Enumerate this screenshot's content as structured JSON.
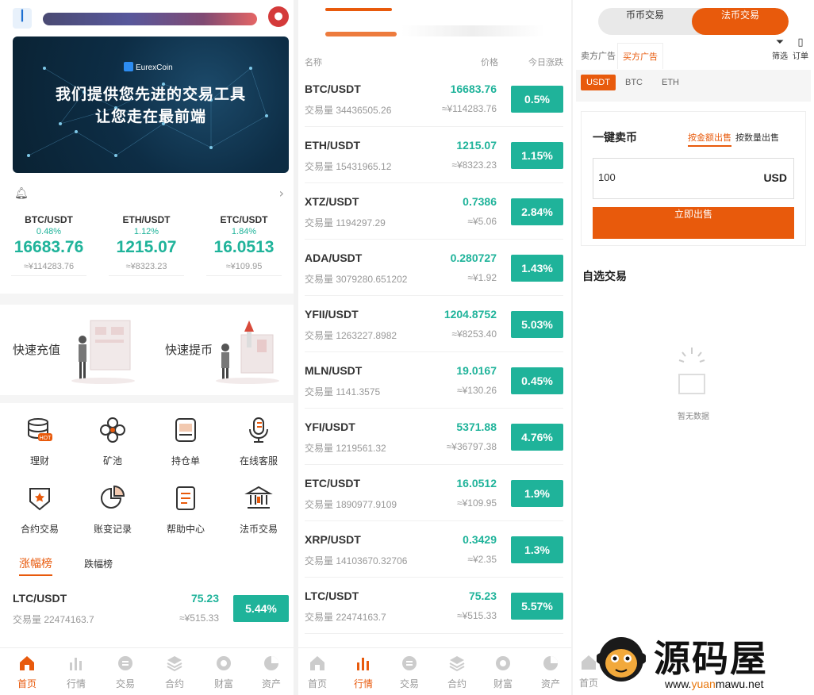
{
  "colors": {
    "accent": "#e85a0c",
    "up": "#1fb39a",
    "muted": "#999999"
  },
  "home": {
    "banner": {
      "brand": "EurexCoin",
      "line1": "我们提供您先进的交易工具",
      "line2": "让您走在最前端"
    },
    "tickers": [
      {
        "pair": "BTC/USDT",
        "change": "0.48%",
        "price": "16683.76",
        "cny": "≈¥114283.76"
      },
      {
        "pair": "ETH/USDT",
        "change": "1.12%",
        "price": "1215.07",
        "cny": "≈¥8323.23"
      },
      {
        "pair": "ETC/USDT",
        "change": "1.84%",
        "price": "16.0513",
        "cny": "≈¥109.95"
      }
    ],
    "quick": {
      "deposit": "快速充值",
      "withdraw": "快速提币"
    },
    "grid": [
      {
        "label": "理财",
        "icon": "coins-hot-icon"
      },
      {
        "label": "矿池",
        "icon": "mining-pool-icon"
      },
      {
        "label": "持仓单",
        "icon": "position-icon"
      },
      {
        "label": "在线客服",
        "icon": "microphone-icon"
      },
      {
        "label": "合约交易",
        "icon": "shield-icon"
      },
      {
        "label": "账变记录",
        "icon": "pie-chart-icon"
      },
      {
        "label": "帮助中心",
        "icon": "document-icon"
      },
      {
        "label": "法币交易",
        "icon": "bank-icon"
      }
    ],
    "tabs": {
      "gainers": "涨幅榜",
      "losers": "跌幅榜"
    },
    "top_row": {
      "pair": "LTC/USDT",
      "vol": "交易量 22474163.7",
      "price": "75.23",
      "cny": "≈¥515.33",
      "pct": "5.44%"
    }
  },
  "market": {
    "header": {
      "name": "名称",
      "price": "价格",
      "change": "今日涨跌"
    },
    "rows": [
      {
        "pair": "BTC/USDT",
        "vol": "交易量 34436505.26",
        "price": "16683.76",
        "cny": "≈¥114283.76",
        "pct": "0.5%"
      },
      {
        "pair": "ETH/USDT",
        "vol": "交易量 15431965.12",
        "price": "1215.07",
        "cny": "≈¥8323.23",
        "pct": "1.15%"
      },
      {
        "pair": "XTZ/USDT",
        "vol": "交易量 1194297.29",
        "price": "0.7386",
        "cny": "≈¥5.06",
        "pct": "2.84%"
      },
      {
        "pair": "ADA/USDT",
        "vol": "交易量 3079280.651202",
        "price": "0.280727",
        "cny": "≈¥1.92",
        "pct": "1.43%"
      },
      {
        "pair": "YFII/USDT",
        "vol": "交易量 1263227.8982",
        "price": "1204.8752",
        "cny": "≈¥8253.40",
        "pct": "5.03%"
      },
      {
        "pair": "MLN/USDT",
        "vol": "交易量 1141.3575",
        "price": "19.0167",
        "cny": "≈¥130.26",
        "pct": "0.45%"
      },
      {
        "pair": "YFI/USDT",
        "vol": "交易量 1219561.32",
        "price": "5371.88",
        "cny": "≈¥36797.38",
        "pct": "4.76%"
      },
      {
        "pair": "ETC/USDT",
        "vol": "交易量 1890977.9109",
        "price": "16.0512",
        "cny": "≈¥109.95",
        "pct": "1.9%"
      },
      {
        "pair": "XRP/USDT",
        "vol": "交易量 14103670.32706",
        "price": "0.3429",
        "cny": "≈¥2.35",
        "pct": "1.3%"
      },
      {
        "pair": "LTC/USDT",
        "vol": "交易量 22474163.7",
        "price": "75.23",
        "cny": "≈¥515.33",
        "pct": "5.57%"
      }
    ]
  },
  "nav": [
    "首页",
    "行情",
    "交易",
    "合约",
    "财富",
    "资产"
  ],
  "otc": {
    "segment": {
      "coin": "币币交易",
      "fiat": "法币交易"
    },
    "ad_tabs": {
      "sell_ads": "卖方广告",
      "buy_ads": "买方广告"
    },
    "filter": "筛选",
    "orders": "订单",
    "coins": [
      "USDT",
      "BTC",
      "ETH"
    ],
    "sell": {
      "title": "一键卖币",
      "mode_amount": "按金额出售",
      "mode_qty": "按数量出售",
      "value": "100",
      "unit": "USD",
      "button": "立即出售"
    },
    "favorites": "自选交易",
    "empty": "暂无数据",
    "nav_first": "首页"
  },
  "watermark": {
    "text": "源码屋",
    "url_pre": "www.",
    "url_o1": "yuan",
    "url_mid": "mawu",
    "url_end": ".net"
  }
}
